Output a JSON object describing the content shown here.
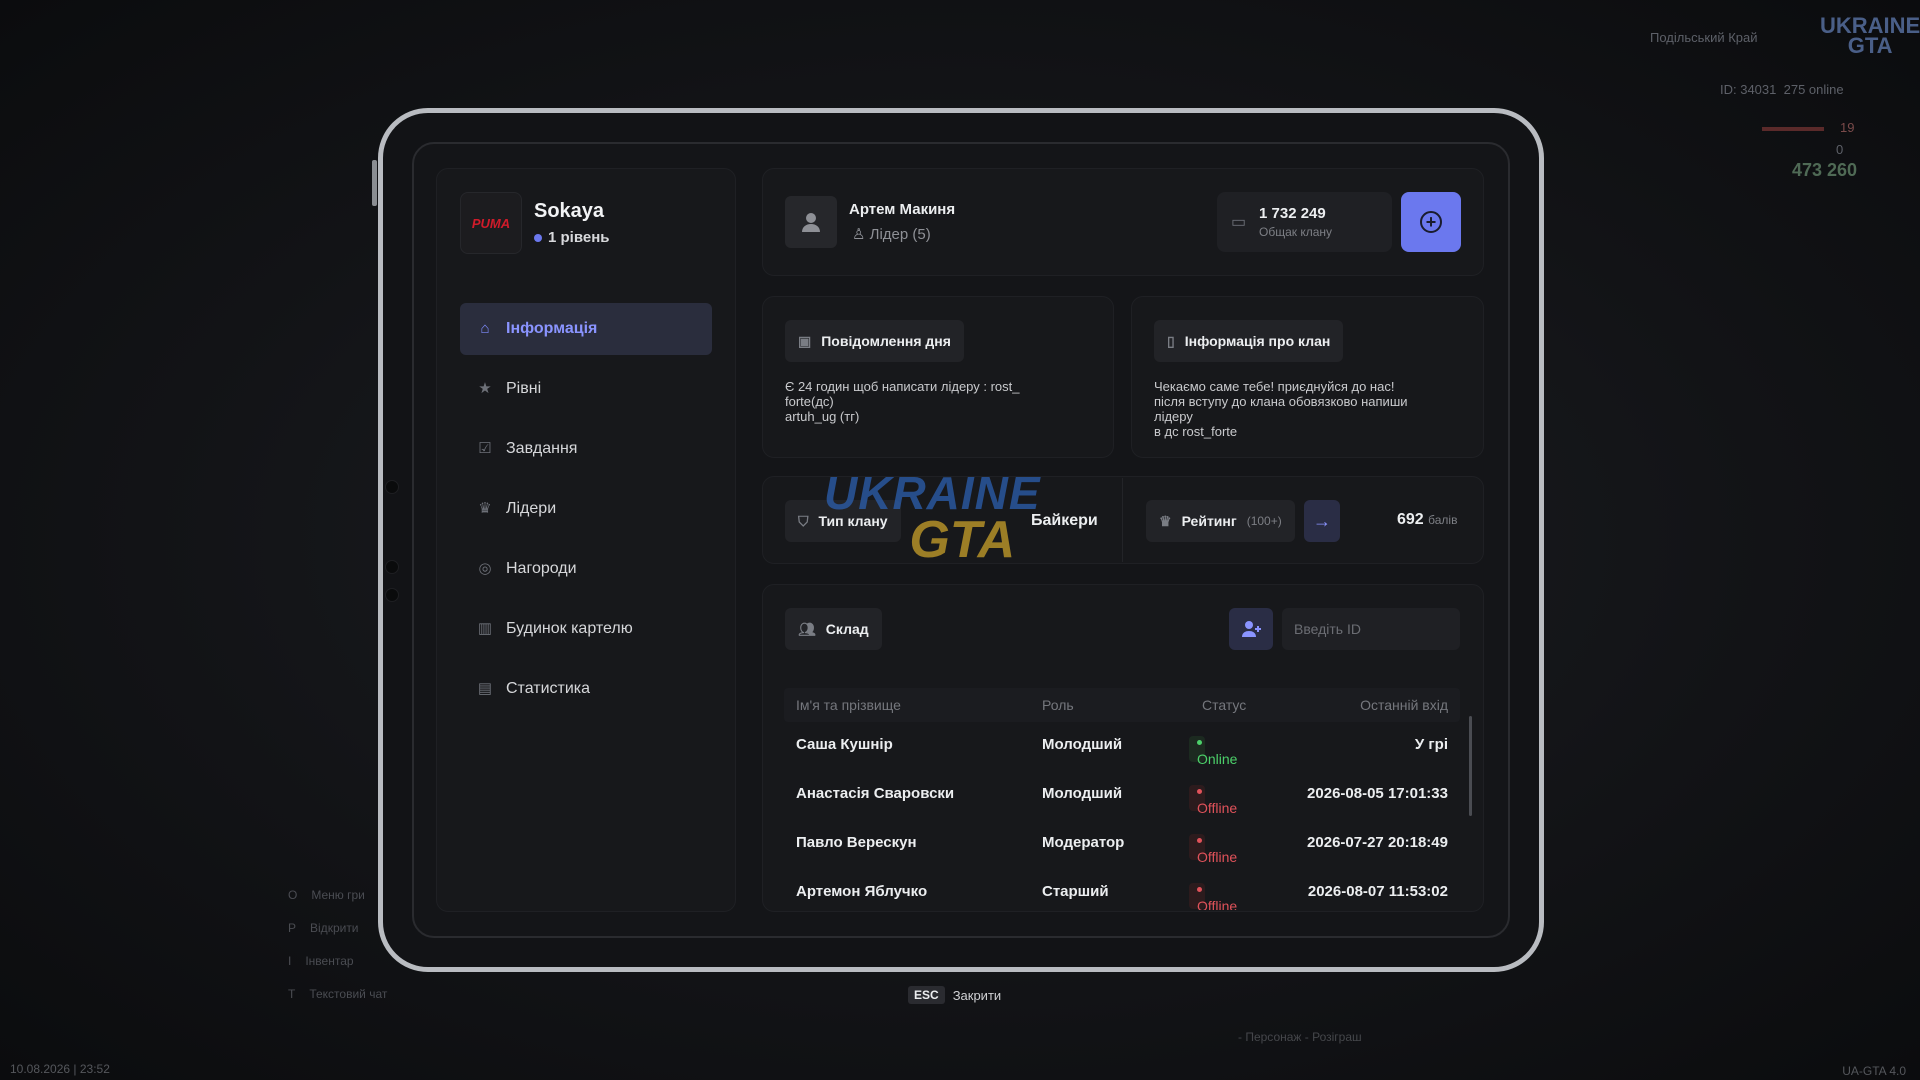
{
  "hud": {
    "region": "Подільський Край",
    "logo_top": "UKRAINE",
    "logo_bottom": "GTA",
    "id": "ID: 34031",
    "online": "275 online",
    "health": "19",
    "armor": "0",
    "money": "473 260",
    "hints": [
      {
        "key": "O",
        "label": "Меню гри"
      },
      {
        "key": "P",
        "label": "Відкрити"
      },
      {
        "key": "I",
        "label": "Інвентар"
      },
      {
        "key": "T",
        "label": "Текстовий чат"
      }
    ],
    "datetime": "10.08.2026 | 23:52",
    "version": "UA-GTA 4.0",
    "promo": "- Персонаж - Розіграш"
  },
  "profile": {
    "logo_text": "PUMA",
    "name": "Sokaya",
    "level": "1 рівень"
  },
  "nav": [
    {
      "label": "Інформація",
      "icon": "home-icon",
      "active": true
    },
    {
      "label": "Рівні",
      "icon": "star-icon"
    },
    {
      "label": "Завдання",
      "icon": "checkbox-icon"
    },
    {
      "label": "Лідери",
      "icon": "crown-icon"
    },
    {
      "label": "Нагороди",
      "icon": "medal-icon"
    },
    {
      "label": "Будинок картелю",
      "icon": "chart-icon"
    },
    {
      "label": "Статистика",
      "icon": "store-icon"
    }
  ],
  "leader": {
    "name": "Артем Макиня",
    "role": "Лідер (5)"
  },
  "bank": {
    "value": "1 732 249",
    "label": "Общак клану"
  },
  "motd": {
    "title": "Повідомлення дня",
    "text": "Є 24 годин щоб  написати лідеру : rost_\nforte(дс)\nartuh_ug (тг)"
  },
  "clan_info": {
    "title": "Інформація про клан",
    "text": "Чекаємо саме тебе! приєднуйся до нас!\nпісля вступу до клана обовязково напиши\nлідеру\nв дс rost_forte"
  },
  "clan_type": {
    "label": "Тип клану",
    "value": "Байкери"
  },
  "rating": {
    "label": "Рейтинг",
    "sub": "(100+)",
    "points": "692",
    "unit": "балів"
  },
  "composition": {
    "title": "Склад",
    "search_placeholder": "Введіть ID",
    "columns": [
      "Ім'я та прізвище",
      "Роль",
      "Статус",
      "Останній вхід"
    ],
    "rows": [
      {
        "name": "Саша Кушнір",
        "role": "Молодший",
        "status": "Online",
        "last": "У грі"
      },
      {
        "name": "Анастасія Сваровски",
        "role": "Молодший",
        "status": "Offline",
        "last": "2026-08-05 17:01:33"
      },
      {
        "name": "Павло Верескун",
        "role": "Модератор",
        "status": "Offline",
        "last": "2026-07-27 20:18:49"
      },
      {
        "name": "Артемон Яблучко",
        "role": "Старший",
        "status": "Offline",
        "last": "2026-08-07 11:53:02"
      }
    ]
  },
  "watermark": {
    "line1": "UKRAINE",
    "line2": "GTA"
  },
  "footer": {
    "key": "ESC",
    "label": "Закрити"
  },
  "colors": {
    "accent": "#6b78ee",
    "online": "#4cd06a",
    "offline": "#e0525a",
    "brand_puma": "#d01b2a"
  }
}
